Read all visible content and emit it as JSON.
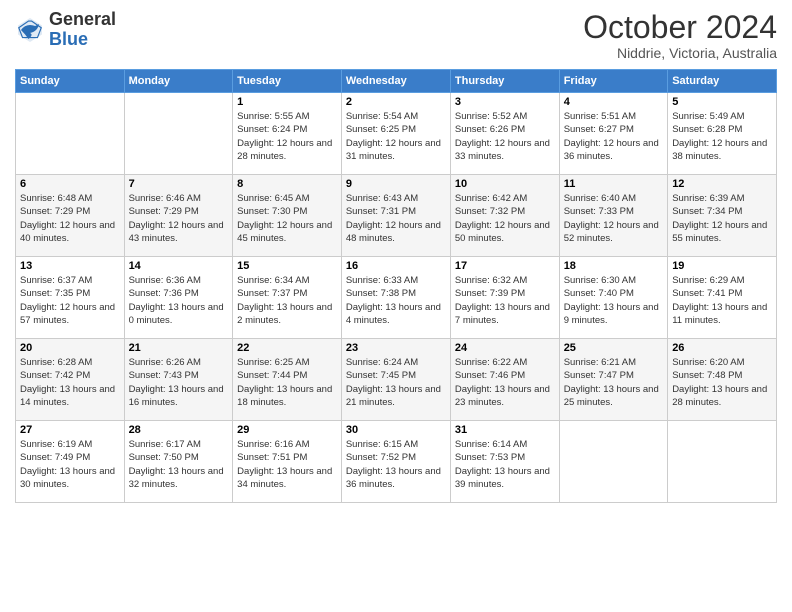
{
  "header": {
    "logo_general": "General",
    "logo_blue": "Blue",
    "month_title": "October 2024",
    "location": "Niddrie, Victoria, Australia"
  },
  "days_of_week": [
    "Sunday",
    "Monday",
    "Tuesday",
    "Wednesday",
    "Thursday",
    "Friday",
    "Saturday"
  ],
  "weeks": [
    [
      {
        "day": "",
        "info": ""
      },
      {
        "day": "",
        "info": ""
      },
      {
        "day": "1",
        "info": "Sunrise: 5:55 AM\nSunset: 6:24 PM\nDaylight: 12 hours and 28 minutes."
      },
      {
        "day": "2",
        "info": "Sunrise: 5:54 AM\nSunset: 6:25 PM\nDaylight: 12 hours and 31 minutes."
      },
      {
        "day": "3",
        "info": "Sunrise: 5:52 AM\nSunset: 6:26 PM\nDaylight: 12 hours and 33 minutes."
      },
      {
        "day": "4",
        "info": "Sunrise: 5:51 AM\nSunset: 6:27 PM\nDaylight: 12 hours and 36 minutes."
      },
      {
        "day": "5",
        "info": "Sunrise: 5:49 AM\nSunset: 6:28 PM\nDaylight: 12 hours and 38 minutes."
      }
    ],
    [
      {
        "day": "6",
        "info": "Sunrise: 6:48 AM\nSunset: 7:29 PM\nDaylight: 12 hours and 40 minutes."
      },
      {
        "day": "7",
        "info": "Sunrise: 6:46 AM\nSunset: 7:29 PM\nDaylight: 12 hours and 43 minutes."
      },
      {
        "day": "8",
        "info": "Sunrise: 6:45 AM\nSunset: 7:30 PM\nDaylight: 12 hours and 45 minutes."
      },
      {
        "day": "9",
        "info": "Sunrise: 6:43 AM\nSunset: 7:31 PM\nDaylight: 12 hours and 48 minutes."
      },
      {
        "day": "10",
        "info": "Sunrise: 6:42 AM\nSunset: 7:32 PM\nDaylight: 12 hours and 50 minutes."
      },
      {
        "day": "11",
        "info": "Sunrise: 6:40 AM\nSunset: 7:33 PM\nDaylight: 12 hours and 52 minutes."
      },
      {
        "day": "12",
        "info": "Sunrise: 6:39 AM\nSunset: 7:34 PM\nDaylight: 12 hours and 55 minutes."
      }
    ],
    [
      {
        "day": "13",
        "info": "Sunrise: 6:37 AM\nSunset: 7:35 PM\nDaylight: 12 hours and 57 minutes."
      },
      {
        "day": "14",
        "info": "Sunrise: 6:36 AM\nSunset: 7:36 PM\nDaylight: 13 hours and 0 minutes."
      },
      {
        "day": "15",
        "info": "Sunrise: 6:34 AM\nSunset: 7:37 PM\nDaylight: 13 hours and 2 minutes."
      },
      {
        "day": "16",
        "info": "Sunrise: 6:33 AM\nSunset: 7:38 PM\nDaylight: 13 hours and 4 minutes."
      },
      {
        "day": "17",
        "info": "Sunrise: 6:32 AM\nSunset: 7:39 PM\nDaylight: 13 hours and 7 minutes."
      },
      {
        "day": "18",
        "info": "Sunrise: 6:30 AM\nSunset: 7:40 PM\nDaylight: 13 hours and 9 minutes."
      },
      {
        "day": "19",
        "info": "Sunrise: 6:29 AM\nSunset: 7:41 PM\nDaylight: 13 hours and 11 minutes."
      }
    ],
    [
      {
        "day": "20",
        "info": "Sunrise: 6:28 AM\nSunset: 7:42 PM\nDaylight: 13 hours and 14 minutes."
      },
      {
        "day": "21",
        "info": "Sunrise: 6:26 AM\nSunset: 7:43 PM\nDaylight: 13 hours and 16 minutes."
      },
      {
        "day": "22",
        "info": "Sunrise: 6:25 AM\nSunset: 7:44 PM\nDaylight: 13 hours and 18 minutes."
      },
      {
        "day": "23",
        "info": "Sunrise: 6:24 AM\nSunset: 7:45 PM\nDaylight: 13 hours and 21 minutes."
      },
      {
        "day": "24",
        "info": "Sunrise: 6:22 AM\nSunset: 7:46 PM\nDaylight: 13 hours and 23 minutes."
      },
      {
        "day": "25",
        "info": "Sunrise: 6:21 AM\nSunset: 7:47 PM\nDaylight: 13 hours and 25 minutes."
      },
      {
        "day": "26",
        "info": "Sunrise: 6:20 AM\nSunset: 7:48 PM\nDaylight: 13 hours and 28 minutes."
      }
    ],
    [
      {
        "day": "27",
        "info": "Sunrise: 6:19 AM\nSunset: 7:49 PM\nDaylight: 13 hours and 30 minutes."
      },
      {
        "day": "28",
        "info": "Sunrise: 6:17 AM\nSunset: 7:50 PM\nDaylight: 13 hours and 32 minutes."
      },
      {
        "day": "29",
        "info": "Sunrise: 6:16 AM\nSunset: 7:51 PM\nDaylight: 13 hours and 34 minutes."
      },
      {
        "day": "30",
        "info": "Sunrise: 6:15 AM\nSunset: 7:52 PM\nDaylight: 13 hours and 36 minutes."
      },
      {
        "day": "31",
        "info": "Sunrise: 6:14 AM\nSunset: 7:53 PM\nDaylight: 13 hours and 39 minutes."
      },
      {
        "day": "",
        "info": ""
      },
      {
        "day": "",
        "info": ""
      }
    ]
  ]
}
